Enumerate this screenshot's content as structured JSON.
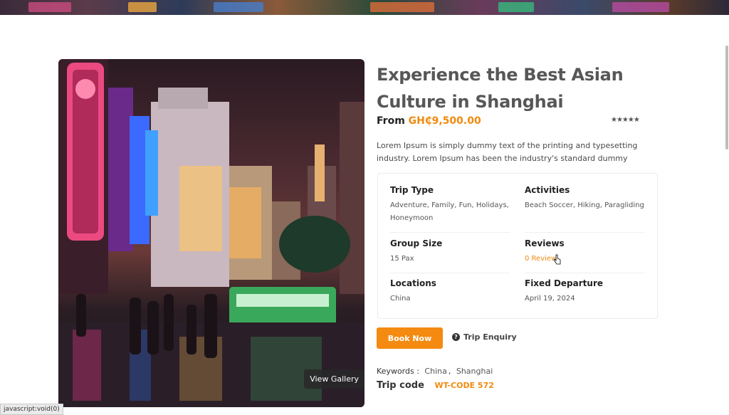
{
  "tour": {
    "title": "Experience the Best Asian Culture in Shanghai",
    "price_prefix": "From",
    "price": "GH₵9,500.00",
    "rating_stars": "★★★★★",
    "description": "Lorem Ipsum is simply dummy text of the printing and typesetting industry. Lorem Ipsum has been the industry's standard dummy"
  },
  "gallery": {
    "view_label": "View Gallery"
  },
  "info": {
    "trip_type_label": "Trip Type",
    "trip_type_value": "Adventure, Family, Fun, Holidays, Honeymoon",
    "activities_label": "Activities",
    "activities_value": "Beach Soccer, Hiking, Paragliding",
    "group_size_label": "Group Size",
    "group_size_value": "15 Pax",
    "reviews_label": "Reviews",
    "reviews_value": "0 Review",
    "locations_label": "Locations",
    "locations_value": "China",
    "departure_label": "Fixed Departure",
    "departure_value": "April 19, 2024"
  },
  "actions": {
    "book_label": "Book Now",
    "enquiry_label": "Trip Enquiry"
  },
  "meta": {
    "keywords_label": "Keywords :",
    "keywords": [
      "China",
      "Shanghai"
    ],
    "tripcode_label": "Trip code",
    "tripcode_value": "WT-CODE 572"
  },
  "status_bar": {
    "url": "javascript:void(0)"
  },
  "colors": {
    "accent": "#f48a10",
    "title": "#575757"
  }
}
